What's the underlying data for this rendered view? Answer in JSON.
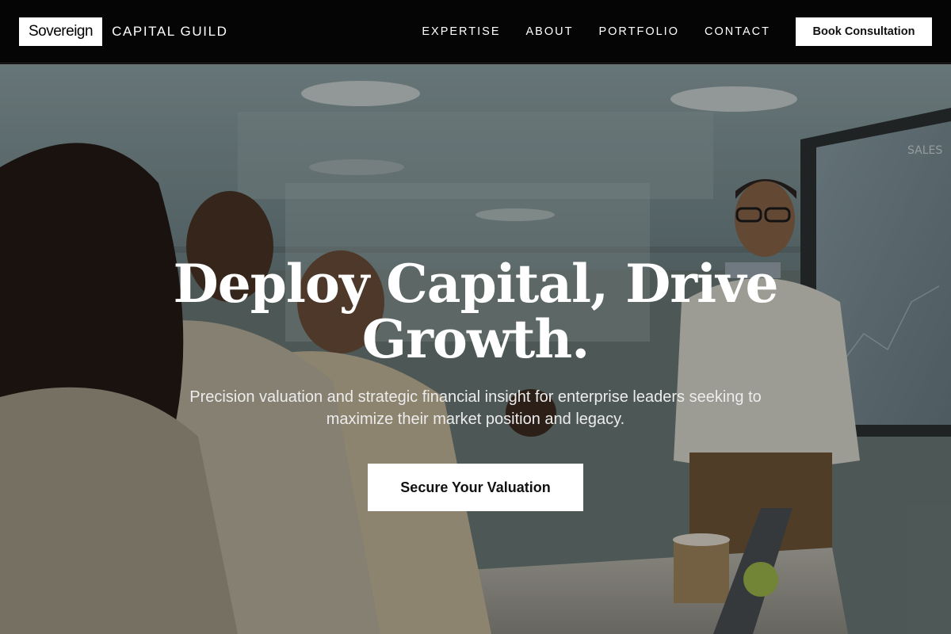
{
  "header": {
    "logo_text": "Sovereign",
    "logo_sub": "CAPITAL GUILD",
    "nav": [
      "EXPERTISE",
      "ABOUT",
      "PORTFOLIO",
      "CONTACT"
    ],
    "cta_label": "Book Consultation"
  },
  "hero": {
    "title": "Deploy Capital, Drive Growth.",
    "subtitle": "Precision valuation and strategic financial insight for enterprise leaders seeking to maximize their market position and legacy.",
    "button_label": "Secure Your Valuation",
    "background_image": "office-meeting-presentation",
    "screen_text": "SALES"
  },
  "colors": {
    "header_bg": "#050505",
    "button_bg": "#ffffff",
    "text_primary": "#ffffff"
  }
}
